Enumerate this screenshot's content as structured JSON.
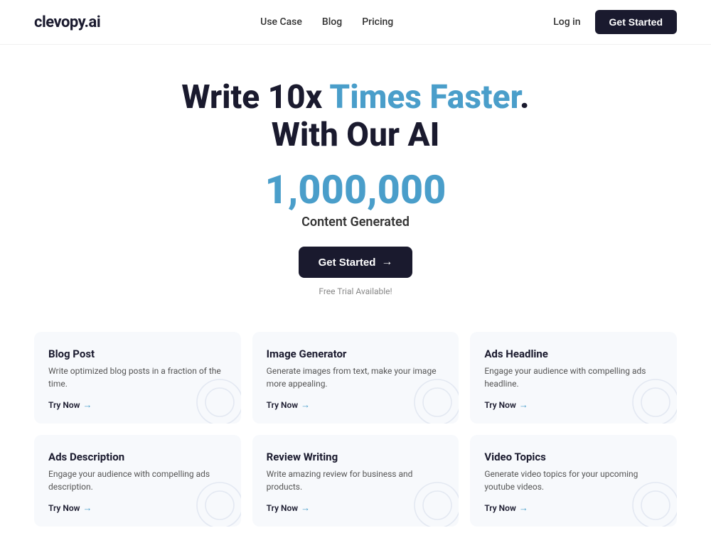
{
  "nav": {
    "logo": "clevopy.ai",
    "links": [
      {
        "label": "Use Case",
        "id": "use-case"
      },
      {
        "label": "Blog",
        "id": "blog"
      },
      {
        "label": "Pricing",
        "id": "pricing"
      }
    ],
    "login_label": "Log in",
    "cta_label": "Get Started"
  },
  "hero": {
    "title_part1": "Write 10x ",
    "title_highlight": "Times Faster",
    "title_period": ".",
    "title_line2": "With Our AI",
    "count": "1,000,000",
    "count_label": "Content Generated",
    "btn_label": "Get Started",
    "btn_arrow": "→",
    "free_trial": "Free Trial Available!"
  },
  "cards": {
    "row1": [
      {
        "id": "blog-post",
        "title": "Blog Post",
        "desc": "Write optimized blog posts in a fraction of the time.",
        "link": "Try Now",
        "arrow": "→"
      },
      {
        "id": "image-generator",
        "title": "Image Generator",
        "desc": "Generate images from text, make your image more appealing.",
        "link": "Try Now",
        "arrow": "→"
      },
      {
        "id": "ads-headline",
        "title": "Ads Headline",
        "desc": "Engage your audience with compelling ads headline.",
        "link": "Try Now",
        "arrow": "→"
      }
    ],
    "row2": [
      {
        "id": "ads-description",
        "title": "Ads Description",
        "desc": "Engage your audience with compelling ads description.",
        "link": "Try Now",
        "arrow": "→"
      },
      {
        "id": "review-writing",
        "title": "Review Writing",
        "desc": "Write amazing review for business and products.",
        "link": "Try Now",
        "arrow": "→"
      },
      {
        "id": "video-topics",
        "title": "Video Topics",
        "desc": "Generate video topics for your upcoming youtube videos.",
        "link": "Try Now",
        "arrow": "→"
      }
    ]
  }
}
